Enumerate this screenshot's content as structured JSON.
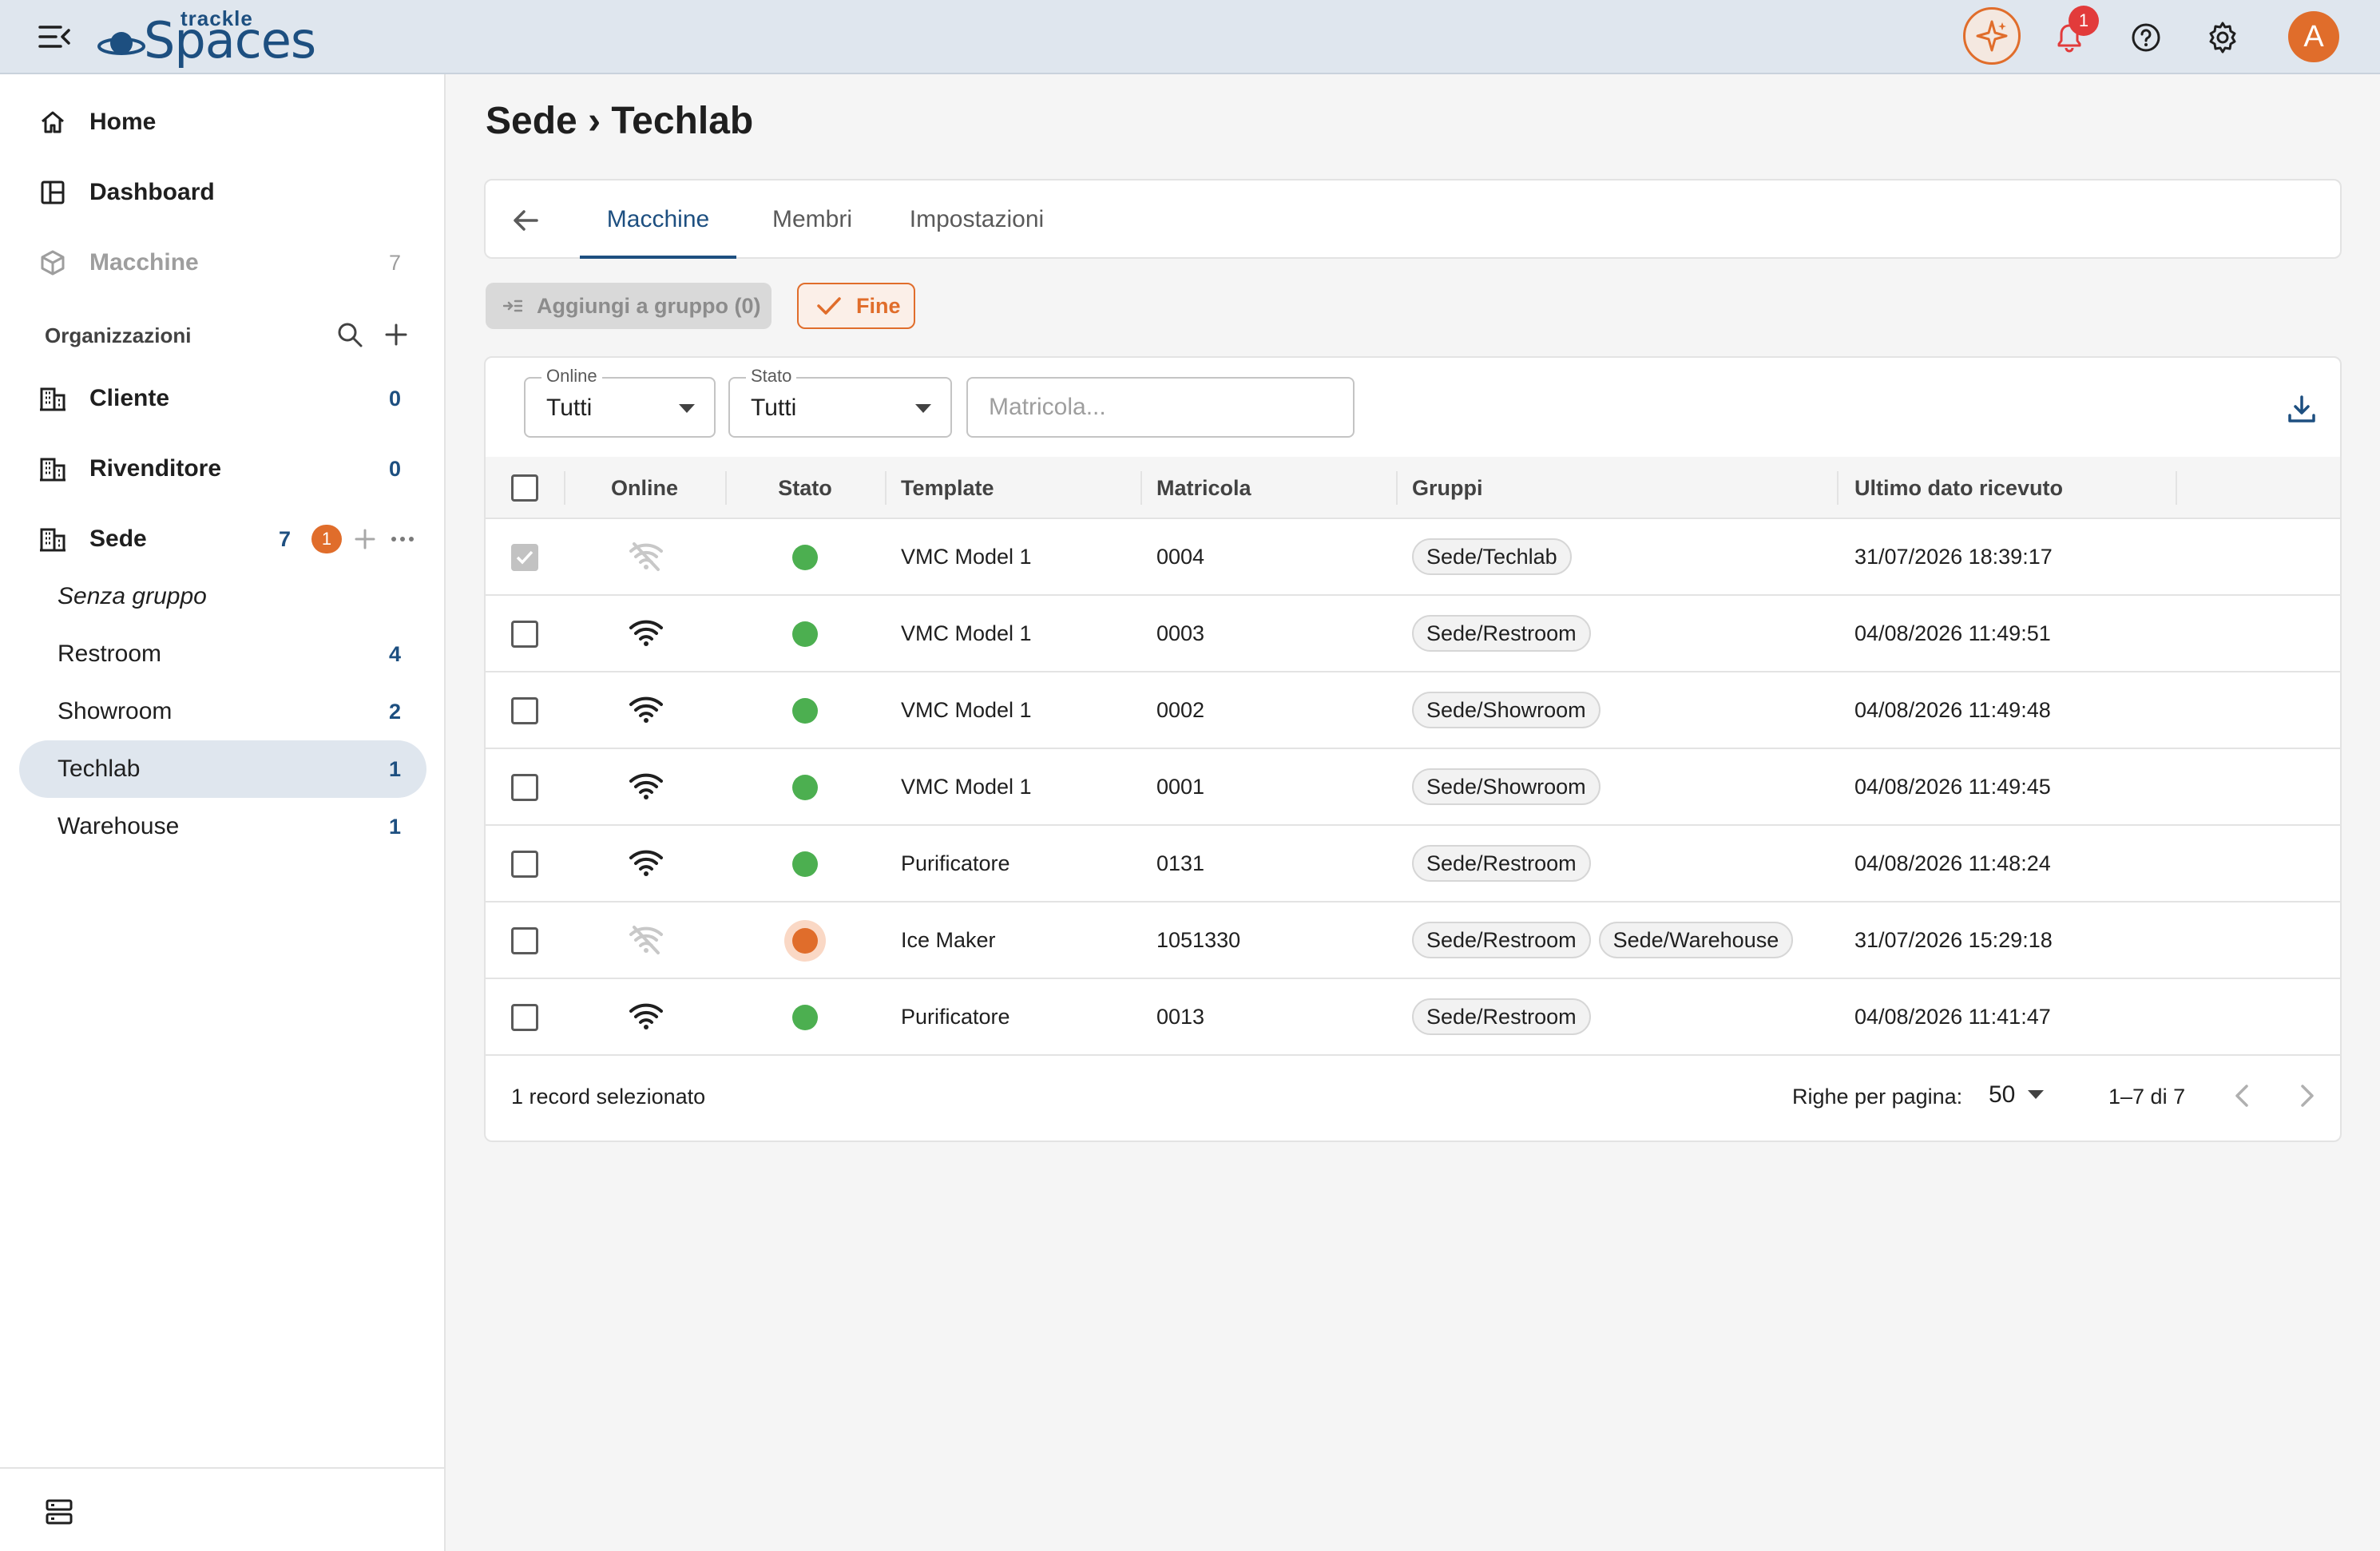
{
  "header": {
    "logo_top": "trackle",
    "logo_main": "Spaces",
    "notifications_count": "1",
    "avatar_initial": "A",
    "accent": "#e06d2b",
    "brand": "#1d4f80"
  },
  "sidebar": {
    "nav": [
      {
        "label": "Home",
        "icon": "home-icon"
      },
      {
        "label": "Dashboard",
        "icon": "dashboard-icon"
      },
      {
        "label": "Macchine",
        "icon": "cube-icon",
        "count": "7"
      }
    ],
    "section_title": "Organizzazioni",
    "orgs": [
      {
        "label": "Cliente",
        "count": "0"
      },
      {
        "label": "Rivenditore",
        "count": "0"
      },
      {
        "label": "Sede",
        "count": "7",
        "badge": "1"
      }
    ],
    "groups": [
      {
        "label": "Senza gruppo",
        "count": ""
      },
      {
        "label": "Restroom",
        "count": "4"
      },
      {
        "label": "Showroom",
        "count": "2"
      },
      {
        "label": "Techlab",
        "count": "1"
      },
      {
        "label": "Warehouse",
        "count": "1"
      }
    ]
  },
  "main": {
    "title": "Sede › Techlab",
    "tabs": [
      {
        "label": "Macchine"
      },
      {
        "label": "Membri"
      },
      {
        "label": "Impostazioni"
      }
    ],
    "add_group_label": "Aggiungi a gruppo (0)",
    "done_label": "Fine",
    "filters": {
      "online": {
        "label": "Online",
        "value": "Tutti"
      },
      "stato": {
        "label": "Stato",
        "value": "Tutti"
      },
      "matricola_placeholder": "Matricola..."
    },
    "columns": [
      "Online",
      "Stato",
      "Template",
      "Matricola",
      "Gruppi",
      "Ultimo dato ricevuto"
    ],
    "rows": [
      {
        "online": false,
        "status": "ok",
        "template": "VMC Model 1",
        "matricola": "0004",
        "groups": [
          "Sede/Techlab"
        ],
        "last": "31/07/2026 18:39:17",
        "selected": true
      },
      {
        "online": true,
        "status": "ok",
        "template": "VMC Model 1",
        "matricola": "0003",
        "groups": [
          "Sede/Restroom"
        ],
        "last": "04/08/2026 11:49:51",
        "selected": false
      },
      {
        "online": true,
        "status": "ok",
        "template": "VMC Model 1",
        "matricola": "0002",
        "groups": [
          "Sede/Showroom"
        ],
        "last": "04/08/2026 11:49:48",
        "selected": false
      },
      {
        "online": true,
        "status": "ok",
        "template": "VMC Model 1",
        "matricola": "0001",
        "groups": [
          "Sede/Showroom"
        ],
        "last": "04/08/2026 11:49:45",
        "selected": false
      },
      {
        "online": true,
        "status": "ok",
        "template": "Purificatore",
        "matricola": "0131",
        "groups": [
          "Sede/Restroom"
        ],
        "last": "04/08/2026 11:48:24",
        "selected": false
      },
      {
        "online": false,
        "status": "warn",
        "template": "Ice Maker",
        "matricola": "1051330",
        "groups": [
          "Sede/Restroom",
          "Sede/Warehouse"
        ],
        "last": "31/07/2026 15:29:18",
        "selected": false
      },
      {
        "online": true,
        "status": "ok",
        "template": "Purificatore",
        "matricola": "0013",
        "groups": [
          "Sede/Restroom"
        ],
        "last": "04/08/2026 11:41:47",
        "selected": false
      }
    ],
    "footer": {
      "selected_text": "1 record selezionato",
      "rows_per_page_label": "Righe per pagina:",
      "rows_per_page": "50",
      "range": "1–7 di 7"
    }
  }
}
